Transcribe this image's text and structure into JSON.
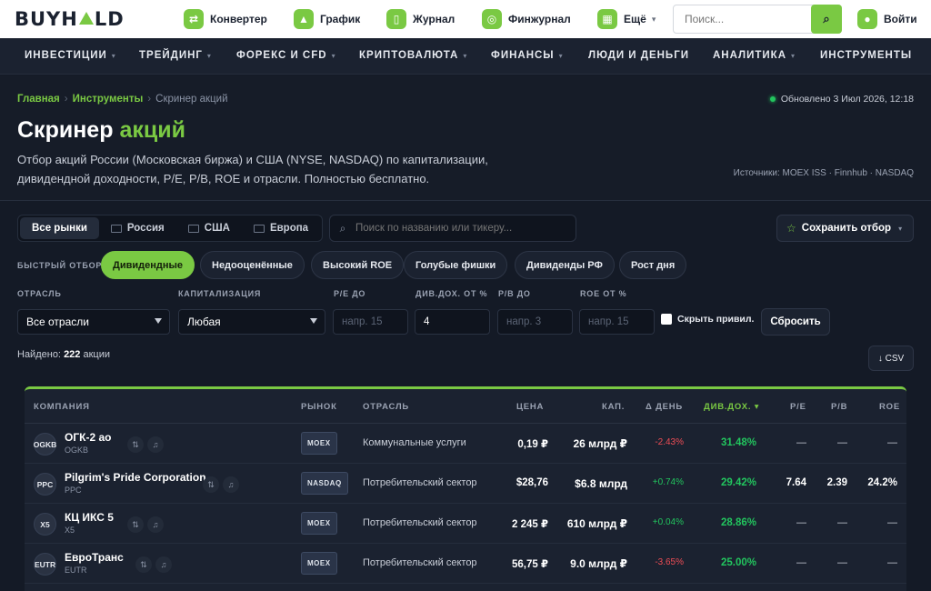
{
  "header": {
    "logo_left": "BUYH",
    "logo_right": "LD",
    "nav": [
      {
        "label": "Конвертер",
        "icon": "exchange-icon"
      },
      {
        "label": "График",
        "icon": "chart-icon"
      },
      {
        "label": "Журнал",
        "icon": "book-icon"
      },
      {
        "label": "Финжурнал",
        "icon": "money-icon"
      },
      {
        "label": "Ещё",
        "icon": "grid-icon"
      }
    ],
    "search_placeholder": "Поиск...",
    "login": "Войти"
  },
  "sections": [
    "ИНВЕСТИЦИИ",
    "ТРЕЙДИНГ",
    "ФОРЕКС И CFD",
    "КРИПТОВАЛЮТА",
    "ФИНАНСЫ",
    "ЛЮДИ И ДЕНЬГИ",
    "АНАЛИТИКА",
    "ИНСТРУМЕНТЫ"
  ],
  "breadcrumb": {
    "home": "Главная",
    "parent": "Инструменты",
    "current": "Скринер акций"
  },
  "updated": "Обновлено 3 Июл 2026, 12:18",
  "title": {
    "main": "Скринер",
    "accent": "акций"
  },
  "description": "Отбор акций России (Московская биржа) и США (NYSE, NASDAQ) по капитализации, дивидендной доходности, P/E, P/B, ROE и отрасли. Полностью бесплатно.",
  "sources": "Источники: MOEX ISS · Finnhub · NASDAQ",
  "markets": [
    "Все рынки",
    "Россия",
    "США",
    "Европа"
  ],
  "query_placeholder": "Поиск по названию или тикеру...",
  "save_filter": "Сохранить отбор",
  "quick": {
    "label": "БЫСТРЫЙ ОТБОР",
    "chips": [
      "Дивидендные",
      "Недооценённые",
      "Высокий ROE",
      "Голубые фишки",
      "Дивиденды РФ",
      "Рост дня"
    ]
  },
  "filters": {
    "sector_label": "ОТРАСЛЬ",
    "sector_value": "Все отрасли",
    "cap_label": "КАПИТАЛИЗАЦИЯ",
    "cap_value": "Любая",
    "pe_label": "P/E ДО",
    "pe_placeholder": "напр. 15",
    "div_label": "ДИВ.ДОХ. ОТ %",
    "div_value": "4",
    "pb_label": "P/B ДО",
    "pb_placeholder": "напр. 3",
    "roe_label": "ROE ОТ %",
    "roe_placeholder": "напр. 15",
    "hide_pref": "Скрыть привил.",
    "reset": "Сбросить"
  },
  "found": {
    "prefix": "Найдено:",
    "count": "222",
    "suffix": "акции"
  },
  "csv": "↓ CSV",
  "table": {
    "columns": {
      "company": "КОМПАНИЯ",
      "market": "РЫНОК",
      "sector": "ОТРАСЛЬ",
      "price": "ЦЕНА",
      "cap": "КАП.",
      "day": "Δ ДЕНЬ",
      "div": "ДИВ.ДОХ. ▾",
      "pe": "P/E",
      "pb": "P/B",
      "roe": "ROE"
    },
    "rows": [
      {
        "ticker": "OGKB",
        "name": "ОГК-2 ао",
        "sub": "OGKB",
        "market": "MOEX",
        "sector": "Коммунальные услуги",
        "price": "0,19 ₽",
        "cap": "26 млрд ₽",
        "day": "-2.43%",
        "div": "31.48%",
        "pe": "—",
        "pb": "—",
        "roe": "—"
      },
      {
        "ticker": "PPC",
        "name": "Pilgrim's Pride Corporation",
        "sub": "PPC",
        "market": "NASDAQ",
        "sector": "Потребительский сектор",
        "price": "$28,76",
        "cap": "$6.8 млрд",
        "day": "+0.74%",
        "div": "29.42%",
        "pe": "7.64",
        "pb": "2.39",
        "roe": "24.2%"
      },
      {
        "ticker": "X5",
        "name": "КЦ ИКС 5",
        "sub": "X5",
        "market": "MOEX",
        "sector": "Потребительский сектор",
        "price": "2 245 ₽",
        "cap": "610 млрд ₽",
        "day": "+0.04%",
        "div": "28.86%",
        "pe": "—",
        "pb": "—",
        "roe": "—"
      },
      {
        "ticker": "EUTR",
        "name": "ЕвроТранс",
        "sub": "EUTR",
        "market": "MOEX",
        "sector": "Потребительский сектор",
        "price": "56,75 ₽",
        "cap": "9.0 млрд ₽",
        "day": "-3.65%",
        "div": "25.00%",
        "pe": "—",
        "pb": "—",
        "roe": "—"
      }
    ]
  },
  "colors": {
    "accent": "#7ac943",
    "bg": "#141a26",
    "positive": "#22c55e",
    "negative": "#ef4d55"
  }
}
